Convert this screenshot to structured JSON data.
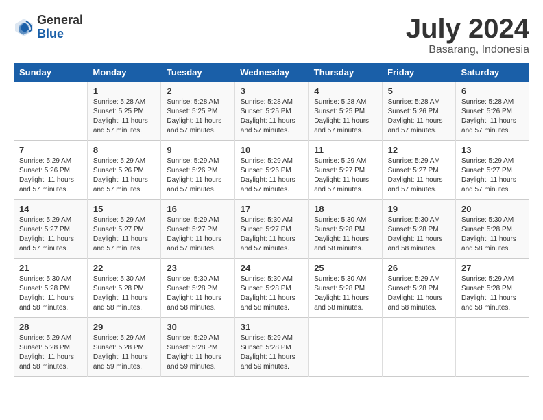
{
  "header": {
    "logo_general": "General",
    "logo_blue": "Blue",
    "month_title": "July 2024",
    "location": "Basarang, Indonesia"
  },
  "columns": [
    "Sunday",
    "Monday",
    "Tuesday",
    "Wednesday",
    "Thursday",
    "Friday",
    "Saturday"
  ],
  "weeks": [
    [
      {
        "day": "",
        "info": ""
      },
      {
        "day": "1",
        "info": "Sunrise: 5:28 AM\nSunset: 5:25 PM\nDaylight: 11 hours\nand 57 minutes."
      },
      {
        "day": "2",
        "info": "Sunrise: 5:28 AM\nSunset: 5:25 PM\nDaylight: 11 hours\nand 57 minutes."
      },
      {
        "day": "3",
        "info": "Sunrise: 5:28 AM\nSunset: 5:25 PM\nDaylight: 11 hours\nand 57 minutes."
      },
      {
        "day": "4",
        "info": "Sunrise: 5:28 AM\nSunset: 5:25 PM\nDaylight: 11 hours\nand 57 minutes."
      },
      {
        "day": "5",
        "info": "Sunrise: 5:28 AM\nSunset: 5:26 PM\nDaylight: 11 hours\nand 57 minutes."
      },
      {
        "day": "6",
        "info": "Sunrise: 5:28 AM\nSunset: 5:26 PM\nDaylight: 11 hours\nand 57 minutes."
      }
    ],
    [
      {
        "day": "7",
        "info": "Sunrise: 5:29 AM\nSunset: 5:26 PM\nDaylight: 11 hours\nand 57 minutes."
      },
      {
        "day": "8",
        "info": "Sunrise: 5:29 AM\nSunset: 5:26 PM\nDaylight: 11 hours\nand 57 minutes."
      },
      {
        "day": "9",
        "info": "Sunrise: 5:29 AM\nSunset: 5:26 PM\nDaylight: 11 hours\nand 57 minutes."
      },
      {
        "day": "10",
        "info": "Sunrise: 5:29 AM\nSunset: 5:26 PM\nDaylight: 11 hours\nand 57 minutes."
      },
      {
        "day": "11",
        "info": "Sunrise: 5:29 AM\nSunset: 5:27 PM\nDaylight: 11 hours\nand 57 minutes."
      },
      {
        "day": "12",
        "info": "Sunrise: 5:29 AM\nSunset: 5:27 PM\nDaylight: 11 hours\nand 57 minutes."
      },
      {
        "day": "13",
        "info": "Sunrise: 5:29 AM\nSunset: 5:27 PM\nDaylight: 11 hours\nand 57 minutes."
      }
    ],
    [
      {
        "day": "14",
        "info": "Sunrise: 5:29 AM\nSunset: 5:27 PM\nDaylight: 11 hours\nand 57 minutes."
      },
      {
        "day": "15",
        "info": "Sunrise: 5:29 AM\nSunset: 5:27 PM\nDaylight: 11 hours\nand 57 minutes."
      },
      {
        "day": "16",
        "info": "Sunrise: 5:29 AM\nSunset: 5:27 PM\nDaylight: 11 hours\nand 57 minutes."
      },
      {
        "day": "17",
        "info": "Sunrise: 5:30 AM\nSunset: 5:27 PM\nDaylight: 11 hours\nand 57 minutes."
      },
      {
        "day": "18",
        "info": "Sunrise: 5:30 AM\nSunset: 5:28 PM\nDaylight: 11 hours\nand 58 minutes."
      },
      {
        "day": "19",
        "info": "Sunrise: 5:30 AM\nSunset: 5:28 PM\nDaylight: 11 hours\nand 58 minutes."
      },
      {
        "day": "20",
        "info": "Sunrise: 5:30 AM\nSunset: 5:28 PM\nDaylight: 11 hours\nand 58 minutes."
      }
    ],
    [
      {
        "day": "21",
        "info": "Sunrise: 5:30 AM\nSunset: 5:28 PM\nDaylight: 11 hours\nand 58 minutes."
      },
      {
        "day": "22",
        "info": "Sunrise: 5:30 AM\nSunset: 5:28 PM\nDaylight: 11 hours\nand 58 minutes."
      },
      {
        "day": "23",
        "info": "Sunrise: 5:30 AM\nSunset: 5:28 PM\nDaylight: 11 hours\nand 58 minutes."
      },
      {
        "day": "24",
        "info": "Sunrise: 5:30 AM\nSunset: 5:28 PM\nDaylight: 11 hours\nand 58 minutes."
      },
      {
        "day": "25",
        "info": "Sunrise: 5:30 AM\nSunset: 5:28 PM\nDaylight: 11 hours\nand 58 minutes."
      },
      {
        "day": "26",
        "info": "Sunrise: 5:29 AM\nSunset: 5:28 PM\nDaylight: 11 hours\nand 58 minutes."
      },
      {
        "day": "27",
        "info": "Sunrise: 5:29 AM\nSunset: 5:28 PM\nDaylight: 11 hours\nand 58 minutes."
      }
    ],
    [
      {
        "day": "28",
        "info": "Sunrise: 5:29 AM\nSunset: 5:28 PM\nDaylight: 11 hours\nand 58 minutes."
      },
      {
        "day": "29",
        "info": "Sunrise: 5:29 AM\nSunset: 5:28 PM\nDaylight: 11 hours\nand 59 minutes."
      },
      {
        "day": "30",
        "info": "Sunrise: 5:29 AM\nSunset: 5:28 PM\nDaylight: 11 hours\nand 59 minutes."
      },
      {
        "day": "31",
        "info": "Sunrise: 5:29 AM\nSunset: 5:28 PM\nDaylight: 11 hours\nand 59 minutes."
      },
      {
        "day": "",
        "info": ""
      },
      {
        "day": "",
        "info": ""
      },
      {
        "day": "",
        "info": ""
      }
    ]
  ]
}
